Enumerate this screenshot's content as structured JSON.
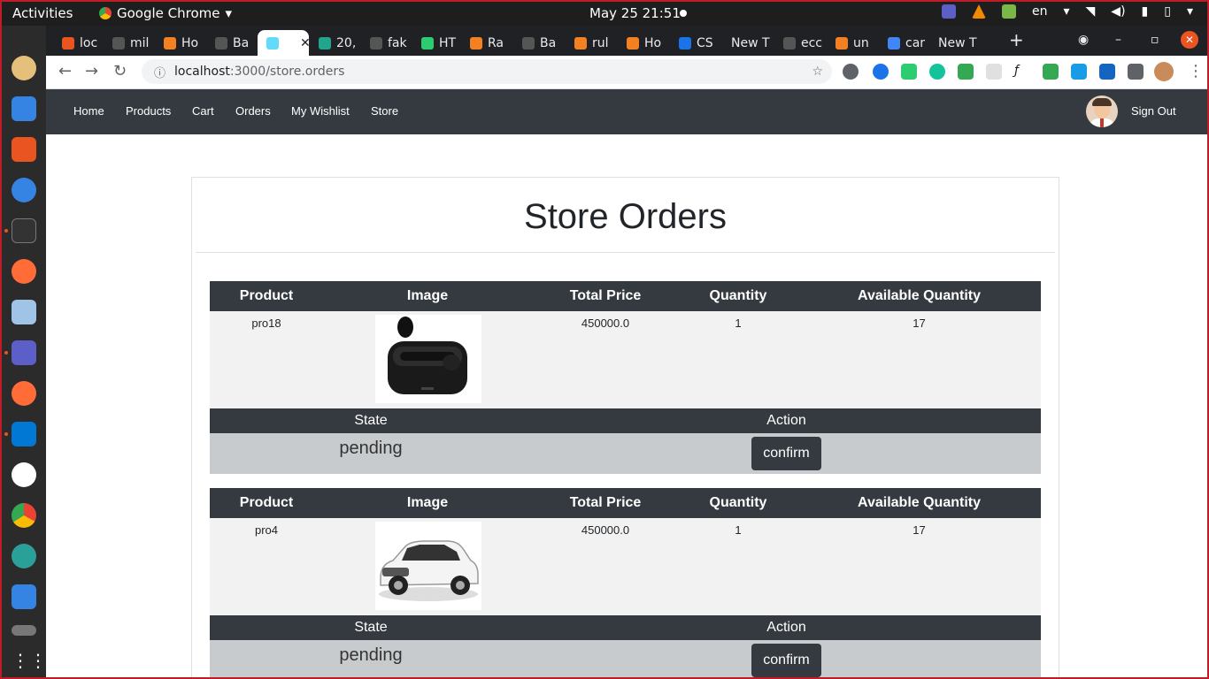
{
  "system": {
    "activities": "Activities",
    "app_name": "Google Chrome",
    "clock": "May 25  21:51",
    "lang": "en"
  },
  "browser": {
    "tabs": [
      {
        "label": "loc",
        "color": "#e95420"
      },
      {
        "label": "mil",
        "color": "#555"
      },
      {
        "label": "Ho",
        "color": "#f48024"
      },
      {
        "label": "Ba",
        "color": "#555"
      },
      {
        "label": "",
        "color": "#61dafb",
        "active": true
      },
      {
        "label": "20,",
        "color": "#21a58c"
      },
      {
        "label": "fak",
        "color": "#555"
      },
      {
        "label": "HT",
        "color": "#2ecc71"
      },
      {
        "label": "Ra",
        "color": "#f48024"
      },
      {
        "label": "Ba",
        "color": "#555"
      },
      {
        "label": "rul",
        "color": "#f48024"
      },
      {
        "label": "Ho",
        "color": "#f48024"
      },
      {
        "label": "CS",
        "color": "#1a73e8"
      },
      {
        "label": "New T",
        "color": ""
      },
      {
        "label": "ecc",
        "color": "#555"
      },
      {
        "label": "un",
        "color": "#f48024"
      },
      {
        "label": "car",
        "color": "#4285f4"
      },
      {
        "label": "New T",
        "color": ""
      }
    ],
    "url_host": "localhost",
    "url_rest": ":3000/store.orders"
  },
  "nav": {
    "links": [
      "Home",
      "Products",
      "Cart",
      "Orders",
      "My Wishlist",
      "Store"
    ],
    "signout": "Sign Out"
  },
  "page": {
    "title": "Store Orders",
    "headers": {
      "product": "Product",
      "image": "Image",
      "total_price": "Total Price",
      "quantity": "Quantity",
      "available": "Available Quantity",
      "state": "State",
      "action": "Action"
    },
    "orders": [
      {
        "product": "pro18",
        "total_price": "450000.0",
        "quantity": "1",
        "available": "17",
        "state": "pending",
        "action": "confirm",
        "image": "earbuds"
      },
      {
        "product": "pro4",
        "total_price": "450000.0",
        "quantity": "1",
        "available": "17",
        "state": "pending",
        "action": "confirm",
        "image": "car"
      }
    ]
  },
  "colors": {
    "navbar": "#343a40",
    "row_bg": "#f2f2f2",
    "state_row_bg": "#c8cbce"
  }
}
